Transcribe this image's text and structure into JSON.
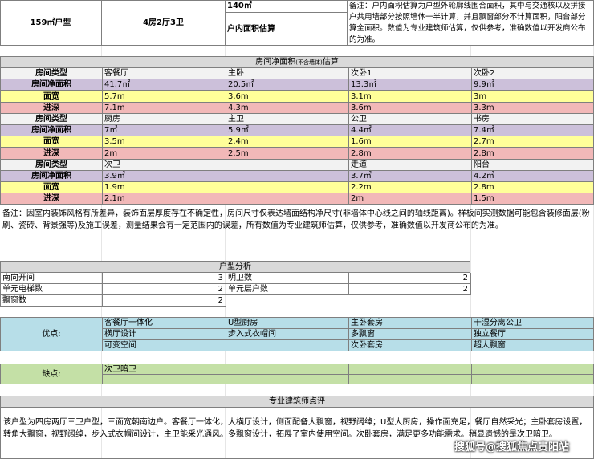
{
  "header": {
    "unit_type": "159㎡户型",
    "layout": "4房2厅3卫",
    "area": "140㎡",
    "area_label": "户内面积估算",
    "note": "备注：户内面积估算为户型外轮廓线围合面积，其中与交通核以及拼接户共用墙部分按照墙体一半计算，并且飘窗部分不计算面积，阳台部分算全面积。数值为专业建筑师估算，仅供参考，准确数值以开发商公布的为准。"
  },
  "room_table": {
    "title": "房间净面积",
    "title_small": "(不含墙体)",
    "title_suffix": "估算",
    "row_labels": [
      "房间类型",
      "房间净面积",
      "面宽",
      "进深"
    ],
    "groups": [
      {
        "types": [
          "客餐厅",
          "主卧",
          "次卧1",
          "次卧2"
        ],
        "areas": [
          "41.7㎡",
          "20.5㎡",
          "13.3㎡",
          "9.9㎡"
        ],
        "widths": [
          "5.7m",
          "3.6m",
          "3.1m",
          "3m"
        ],
        "depths": [
          "7.1m",
          "4.3m",
          "3.6m",
          "3.3m"
        ]
      },
      {
        "types": [
          "厨房",
          "主卫",
          "公卫",
          "书房"
        ],
        "areas": [
          "7㎡",
          "5.9㎡",
          "4.4㎡",
          "7.4㎡"
        ],
        "widths": [
          "3.5m",
          "2.4m",
          "1.6m",
          "2.7m"
        ],
        "depths": [
          "2m",
          "2.5m",
          "2.8m",
          "2.8m"
        ]
      },
      {
        "types": [
          "次卫",
          "",
          "走道",
          "阳台"
        ],
        "areas": [
          "3.9㎡",
          "",
          "3.7㎡",
          "4.2㎡"
        ],
        "widths": [
          "1.9m",
          "",
          "2.2m",
          "2.8m"
        ],
        "depths": [
          "2.1m",
          "",
          "2m",
          "1.5m"
        ]
      }
    ],
    "note": "备注：因室内装饰风格有所差异，装饰面层厚度存在不确定性，房间尺寸仅表达墙面结构净尺寸(非墙体中心线之间的轴线距离)。样板间实测数据可能包含装修面层(粉刷、瓷砖、背景强等)及施工误差，测量结果会有一定范围内的误差，所有数值为专业建筑师估算，仅供参考，准确数值以开发商公布的为准。"
  },
  "analysis": {
    "title": "户型分析",
    "rows": [
      {
        "l_label": "南向开间",
        "l_value": "3",
        "r_label": "明卫数",
        "r_value": "2"
      },
      {
        "l_label": "单元电梯数",
        "l_value": "2",
        "r_label": "单元层户数",
        "r_value": "2"
      },
      {
        "l_label": "飘窗数",
        "l_value": "2",
        "r_label": "",
        "r_value": ""
      }
    ]
  },
  "pros": {
    "label": "优点:",
    "rows": [
      [
        "客餐厅一体化",
        "U型厨房",
        "主卧套房",
        "干湿分离公卫"
      ],
      [
        "横厅设计",
        "步入式衣帽间",
        "多飘窗",
        "独立餐厅"
      ],
      [
        "可变空间",
        "",
        "次卧套房",
        "超大飘窗"
      ]
    ]
  },
  "cons": {
    "label": "缺点:",
    "items": [
      "次卫暗卫"
    ]
  },
  "review": {
    "title": "专业建筑师点评",
    "text": "该户型为四房两厅三卫户型，三面宽朝南边户。客餐厅一体化，大横厅设计，侧面配备大飘窗，视野阔绰；U型大厨房，操作面充足，餐厅自然采光；主卧套房设置，转角大飘窗，视野阔绰，步入式衣帽间设计，主卫能采光通风。多飘窗设计，拓展了室内使用空间。次卧套房，满足更多功能需求。稍显遗憾的是次卫暗卫。"
  },
  "watermark": "搜狐号@搜狐焦点贵阳站"
}
